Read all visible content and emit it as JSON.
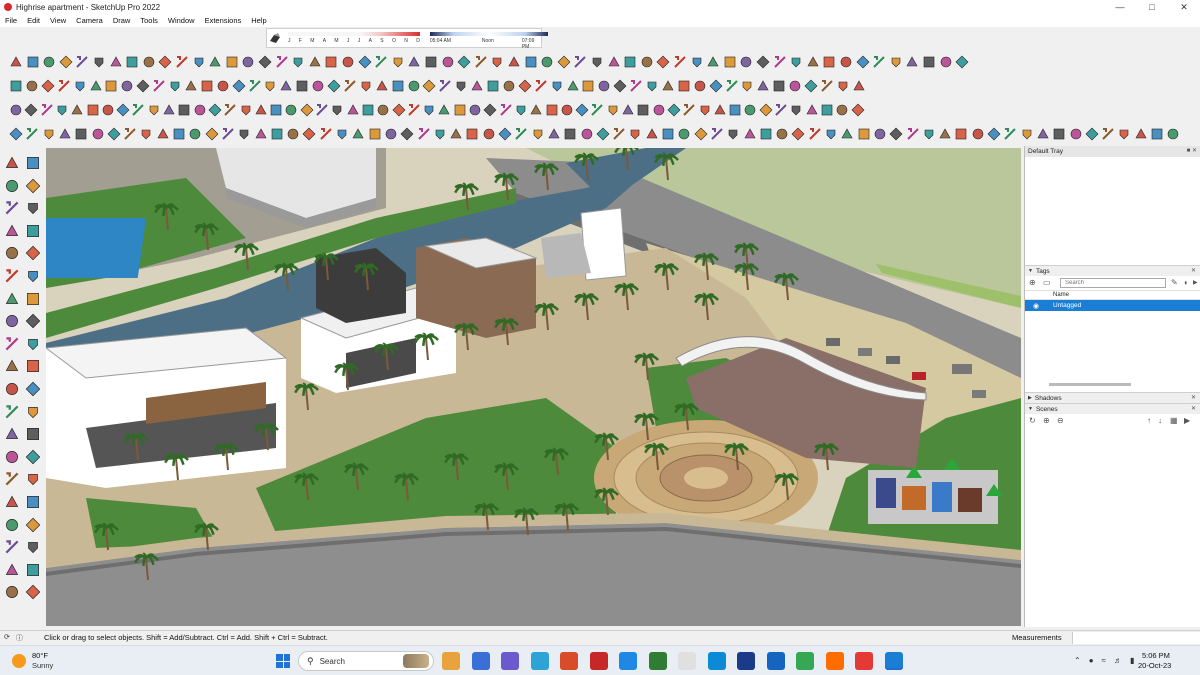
{
  "window": {
    "title": "Highrise apartment - SketchUp Pro 2022",
    "controls": [
      "minimize",
      "maximize",
      "close"
    ]
  },
  "menu": [
    "File",
    "Edit",
    "View",
    "Camera",
    "Draw",
    "Tools",
    "Window",
    "Extensions",
    "Help"
  ],
  "shadow_settings": {
    "months": [
      "J",
      "F",
      "M",
      "A",
      "M",
      "J",
      "J",
      "A",
      "S",
      "O",
      "N",
      "D"
    ],
    "time_start": "05:04 AM",
    "time_mid": "Noon",
    "time_end": "07:09 PM"
  },
  "tray": {
    "title": "Default Tray",
    "tags_panel": {
      "title": "Tags",
      "search_placeholder": "Search",
      "column_name": "Name",
      "rows": [
        {
          "name": "Untagged",
          "selected": true
        }
      ]
    },
    "shadows_panel": {
      "title": "Shadows"
    },
    "scenes_panel": {
      "title": "Scenes"
    }
  },
  "status": {
    "message": "Click or drag to select objects. Shift = Add/Subtract. Ctrl = Add. Shift + Ctrl = Subtract.",
    "measurements_label": "Measurements",
    "measurements_value": ""
  },
  "taskbar": {
    "weather_temp": "80°F",
    "weather_condition": "Sunny",
    "search_label": "Search",
    "time": "5:06 PM",
    "date": "20-Oct-23"
  },
  "colors": {
    "accent_select": "#1a7fd4",
    "grass": "#4e8a3c",
    "water": "#4d6f86",
    "road": "#8a8a8a"
  }
}
